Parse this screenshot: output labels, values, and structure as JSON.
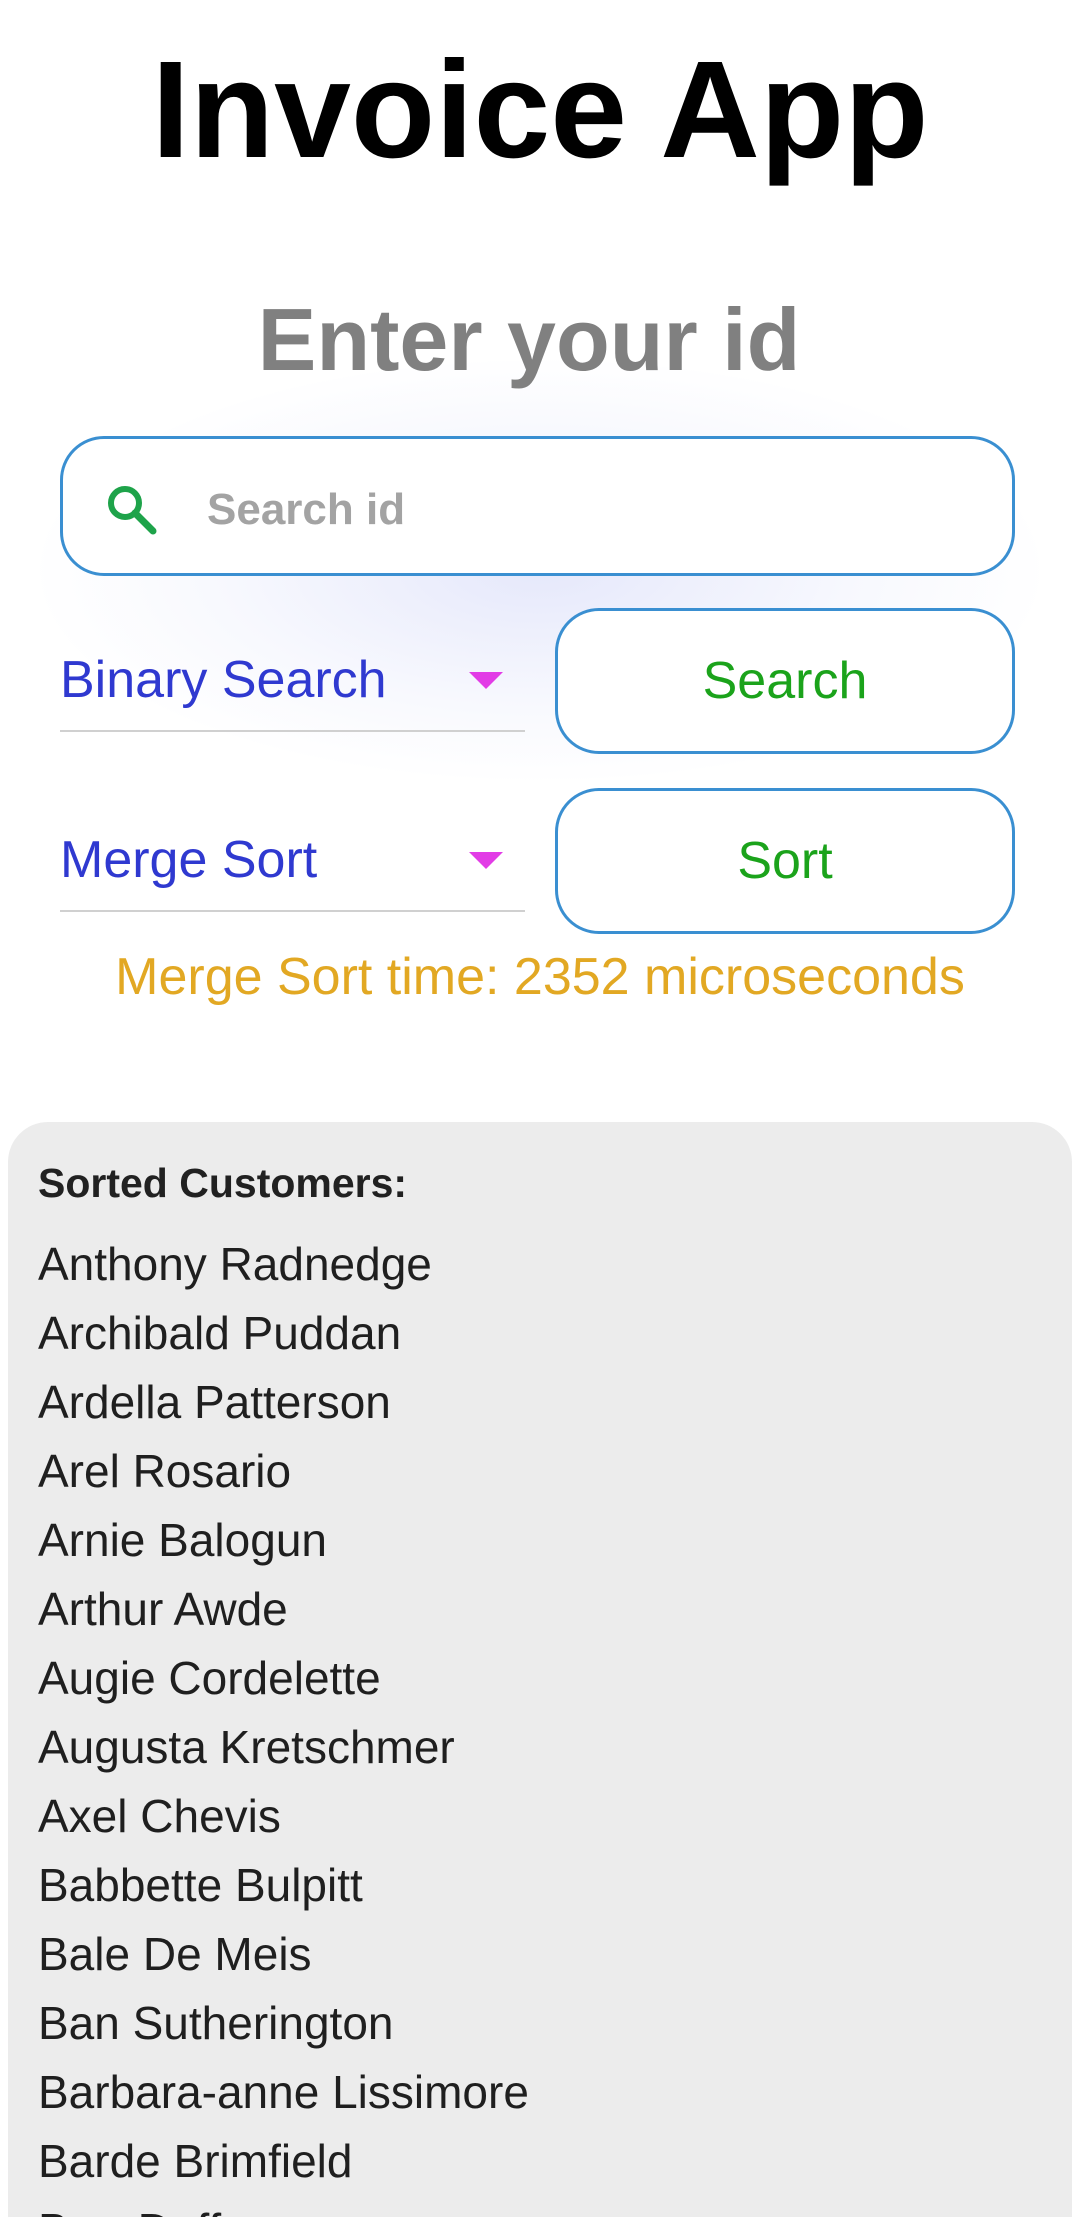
{
  "header": {
    "title": "Invoice App"
  },
  "search": {
    "prompt": "Enter your id",
    "placeholder": "Search id",
    "value": ""
  },
  "controls": {
    "search_algorithm": "Binary Search",
    "search_button": "Search",
    "sort_algorithm": "Merge Sort",
    "sort_button": "Sort"
  },
  "status": {
    "sort_time": "Merge Sort time: 2352 microseconds"
  },
  "customers": {
    "heading": "Sorted Customers:",
    "items": [
      "Anthony Radnedge",
      "Archibald Puddan",
      "Ardella Patterson",
      "Arel Rosario",
      "Arnie Balogun",
      "Arthur Awde",
      "Augie Cordelette",
      "Augusta Kretschmer",
      "Axel Chevis",
      "Babbette Bulpitt",
      "Bale De Meis",
      "Ban Sutherington",
      "Barbara-anne Lissimore",
      "Barde Brimfield",
      "Barr Duff"
    ]
  },
  "colors": {
    "input_border": "#3a8fd1",
    "dropdown_text": "#2f39d0",
    "dropdown_arrow": "#e23ce6",
    "button_text": "#1ba31b",
    "status_text": "#e2a823",
    "panel_background": "#ececec"
  },
  "icons": {
    "search": "search-icon",
    "dropdown": "triangle-down-icon"
  }
}
